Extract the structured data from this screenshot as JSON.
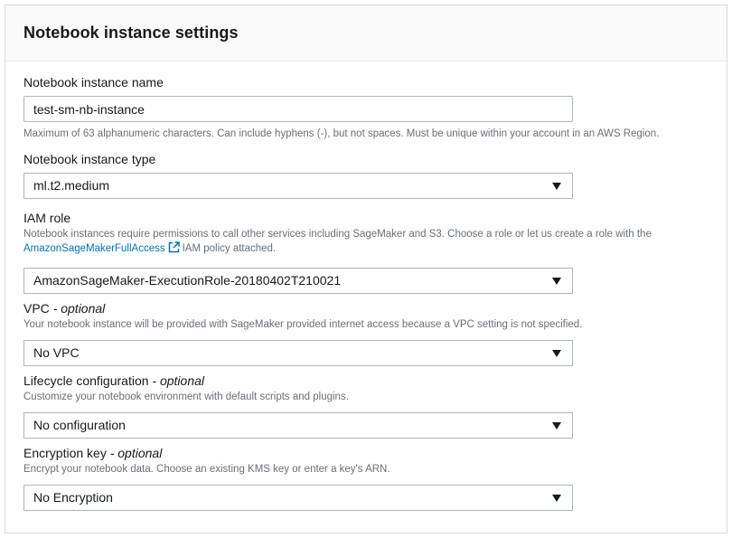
{
  "panel": {
    "title": "Notebook instance settings"
  },
  "name_field": {
    "label": "Notebook instance name",
    "value": "test-sm-nb-instance",
    "hint": "Maximum of 63 alphanumeric characters. Can include hyphens (-), but not spaces. Must be unique within your account in an AWS Region."
  },
  "type_field": {
    "label": "Notebook instance type",
    "value": "ml.t2.medium"
  },
  "iam_field": {
    "label": "IAM role",
    "desc_line1": "Notebook instances require permissions to call other services including SageMaker and S3. Choose a role or let us create a role with the",
    "link": "AmazonSageMakerFullAccess",
    "desc_suffix": "IAM policy attached.",
    "value": "AmazonSageMaker-ExecutionRole-20180402T210021"
  },
  "vpc_field": {
    "label": "VPC",
    "optional": "- optional",
    "desc": "Your notebook instance will be provided with SageMaker provided internet access because a VPC setting is not specified.",
    "value": "No VPC"
  },
  "lifecycle_field": {
    "label": "Lifecycle configuration",
    "optional": "- optional",
    "desc": "Customize your notebook environment with default scripts and plugins.",
    "value": "No configuration"
  },
  "encryption_field": {
    "label": "Encryption key",
    "optional": "- optional",
    "desc": "Encrypt your notebook data. Choose an existing KMS key or enter a key's ARN.",
    "value": "No Encryption"
  },
  "icons": {
    "external_link": "external-link-icon",
    "dropdown": "caret-down-icon"
  },
  "colors": {
    "link": "#0073bb",
    "border": "#aab7b8",
    "hint": "#687078"
  }
}
